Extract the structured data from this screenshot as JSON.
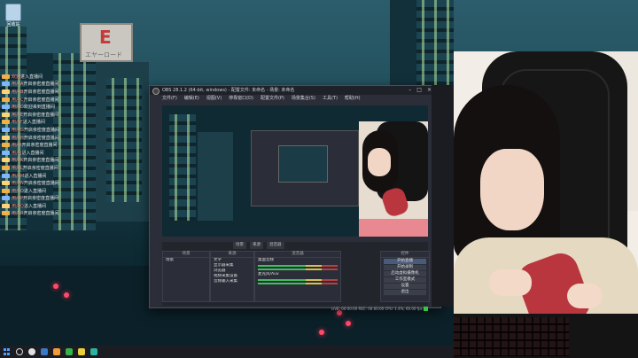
{
  "desktop": {
    "recycle_bin_label": "回收站"
  },
  "sign": {
    "big": "E",
    "small": "エヤーロード"
  },
  "chat": {
    "lines": [
      {
        "name": "欢迎",
        "msg": "进入直播间"
      },
      {
        "name": "用户A",
        "msg": "开启亲密度直播间"
      },
      {
        "name": "用户B",
        "msg": "开启亲密度直播间"
      },
      {
        "name": "用户C",
        "msg": "开启亲密度直播间"
      },
      {
        "name": "用户D",
        "msg": "欢迎来到直播间"
      },
      {
        "name": "用户E",
        "msg": "开启亲密度直播间"
      },
      {
        "name": "用户F",
        "msg": "进入直播间"
      },
      {
        "name": "用户G",
        "msg": "开启亲密度直播间"
      },
      {
        "name": "用户H",
        "msg": "开启亲密度直播间"
      },
      {
        "name": "用户I",
        "msg": "开启亲密度直播间"
      },
      {
        "name": "用户J",
        "msg": "进入直播间"
      },
      {
        "name": "用户K",
        "msg": "开启亲密度直播间"
      },
      {
        "name": "用户L",
        "msg": "开启亲密度直播间"
      },
      {
        "name": "用户M",
        "msg": "进入直播间"
      },
      {
        "name": "用户N",
        "msg": "开启亲密度直播间"
      },
      {
        "name": "用户O",
        "msg": "进入直播间"
      },
      {
        "name": "用户P",
        "msg": "开启亲密度直播间"
      },
      {
        "name": "用户Q",
        "msg": "进入直播间"
      },
      {
        "name": "用户R",
        "msg": "开启亲密度直播间"
      }
    ]
  },
  "obs": {
    "title": "OBS 28.1.2 (64-bit, windows) - 配置文件: 未命名 - 场景: 未命名",
    "menu": [
      "文件(F)",
      "编辑(E)",
      "视图(V)",
      "停靠窗口(D)",
      "配置文件(P)",
      "场景集合(S)",
      "工具(T)",
      "帮助(H)"
    ],
    "tabs": [
      "场景",
      "来源",
      "混音器"
    ],
    "scenes_header": "场景",
    "scenes": [
      "场景"
    ],
    "sources_header": "来源",
    "sources": [
      "文字",
      "显示器采集",
      "浏览器",
      "视频采集设备",
      "音频输入采集"
    ],
    "mixer_header": "混音器",
    "mixer": [
      "桌面音频",
      "麦克风/Aux"
    ],
    "controls_header": "控件",
    "controls": [
      "开始直播",
      "开始录制",
      "启动虚拟摄像机",
      "工作室模式",
      "设置",
      "退出"
    ],
    "status": "LIVE: 00:00:00  REC: 00:00:00  CPU: 1.4%, 60.00 fps"
  }
}
